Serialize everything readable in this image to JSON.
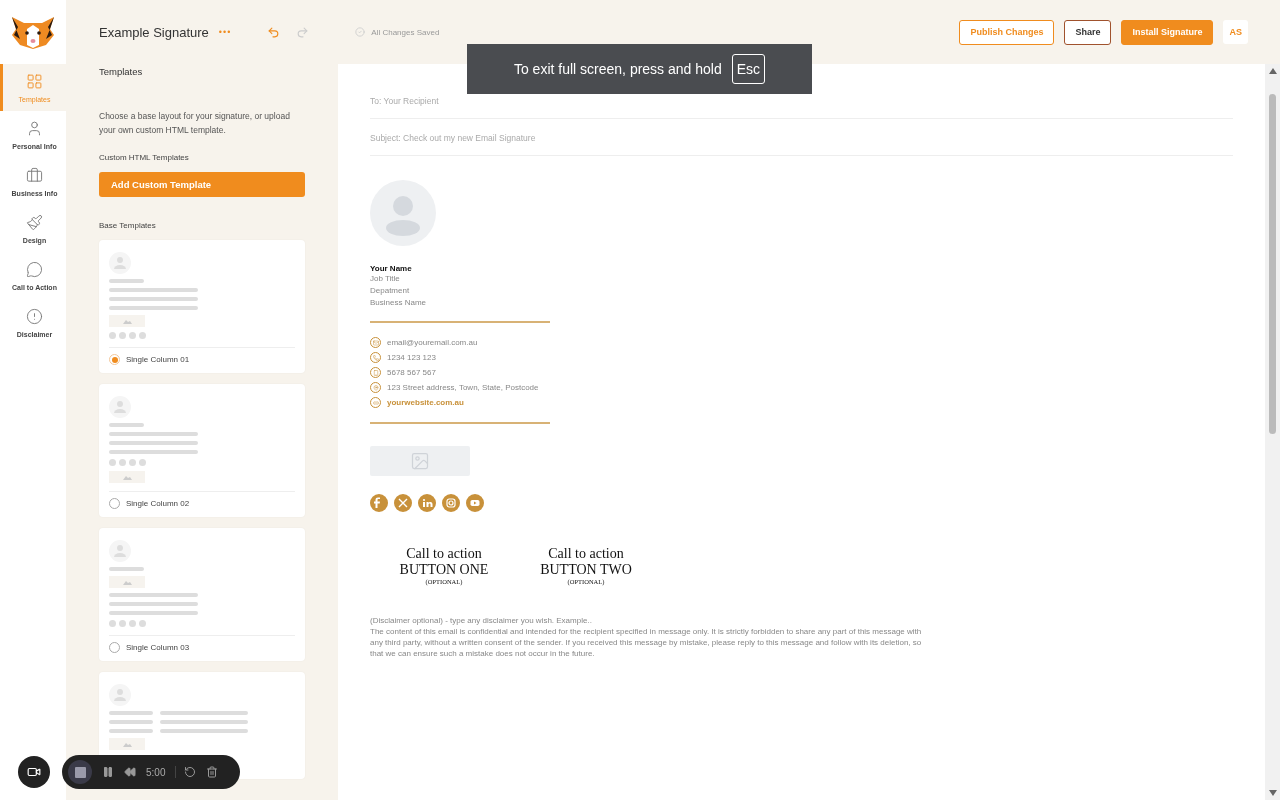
{
  "nav": [
    {
      "label": "Templates",
      "selected": true
    },
    {
      "label": "Personal Info",
      "selected": false
    },
    {
      "label": "Business Info",
      "selected": false
    },
    {
      "label": "Design",
      "selected": false
    },
    {
      "label": "Call to Action",
      "selected": false
    },
    {
      "label": "Disclaimer",
      "selected": false
    }
  ],
  "header": {
    "title": "Example Signature",
    "more": "•••",
    "saved": "All Changes Saved",
    "avatar": "AS",
    "buttons": [
      {
        "label": "Publish Changes",
        "kind": "outline-accent"
      },
      {
        "label": "Share",
        "kind": "outline"
      },
      {
        "label": "Install Signature",
        "kind": "primary"
      }
    ]
  },
  "panel": {
    "heading": "Templates",
    "description": "Choose a base layout for your signature, or upload your own custom HTML template.",
    "custom_label": "Custom HTML Templates",
    "custom_button": "Add Custom Template",
    "base_label": "Base Templates",
    "templates": [
      {
        "name": "Single Column 01",
        "kind": "lines-image-dots",
        "selected": true
      },
      {
        "name": "Single Column 02",
        "kind": "lines-dots-image",
        "selected": false
      },
      {
        "name": "Single Column 03",
        "kind": "image-lines-dots",
        "selected": false
      },
      {
        "kind": "two-column"
      }
    ]
  },
  "email": {
    "to": "To: Your Recipient",
    "subject": "Subject: Check out my new Email Signature",
    "name": "Your Name",
    "details": [
      "Job Title",
      "Depatment",
      "Business Name"
    ],
    "contacts": [
      {
        "kind": "email",
        "text": "email@youremail.com.au"
      },
      {
        "kind": "phone",
        "text": "1234 123 123"
      },
      {
        "kind": "mobile",
        "text": "5678 567 567"
      },
      {
        "kind": "address",
        "text": "123 Street address, Town, State, Postcode"
      },
      {
        "kind": "website",
        "text": "yourwebsite.com.au"
      }
    ],
    "cta": [
      {
        "line1": "Call to action",
        "line2": "BUTTON ONE",
        "note": "(OPTIONAL)"
      },
      {
        "line1": "Call to action",
        "line2": "BUTTON TWO",
        "note": "(OPTIONAL)"
      }
    ],
    "disclaimer": [
      "(Disclaimer optional) - type any disclaimer you wish. Example..",
      "The content of this email is confidential and intended for the recipient specified in message only. It is strictly forbidden to share any part of this message with any third party, without a written consent of the sender. If you received this message by mistake, please reply to this message and follow with its deletion, so that we can ensure such a mistake does not occur in the future."
    ]
  },
  "fullscreen_notice": {
    "text": "To exit full screen, press and hold",
    "key": "Esc"
  },
  "recorder": {
    "time": "5:00"
  }
}
